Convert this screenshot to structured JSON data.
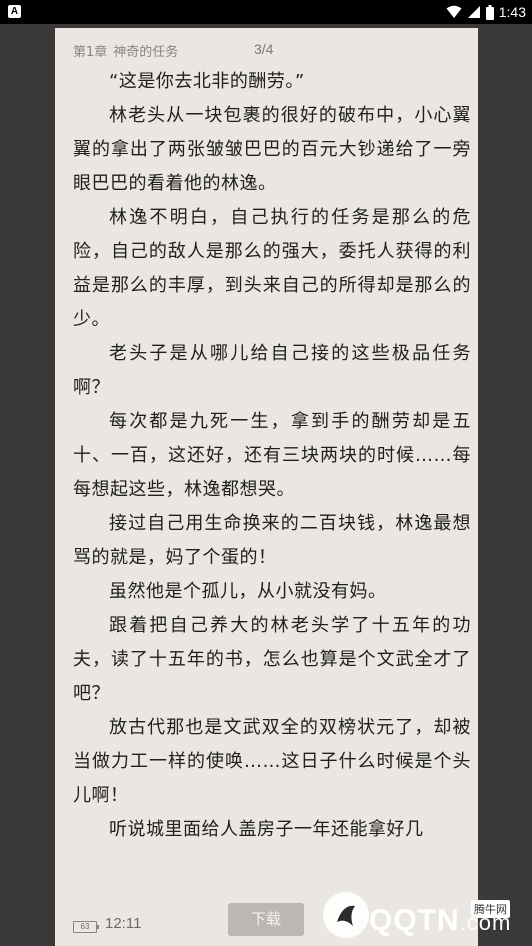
{
  "status_bar": {
    "app_icon_letter": "A",
    "time": "1:43",
    "icons": [
      "wifi-icon",
      "signal-icon",
      "battery-icon"
    ]
  },
  "reader": {
    "chapter_number": "第1章",
    "chapter_title": "神奇的任务",
    "page_indicator": "3/4",
    "paragraphs": [
      "“这是你去北非的酬劳。”",
      "林老头从一块包裹的很好的破布中，小心翼翼的拿出了两张皱皱巴巴的百元大钞递给了一旁眼巴巴的看着他的林逸。",
      "林逸不明白，自己执行的任务是那么的危险，自己的敌人是那么的强大，委托人获得的利益是那么的丰厚，到头来自己的所得却是那么的少。",
      "老头子是从哪儿给自己接的这些极品任务啊？",
      "每次都是九死一生，拿到手的酬劳却是五十、一百，这还好，还有三块两块的时候……每每想起这些，林逸都想哭。",
      "接过自己用生命换来的二百块钱，林逸最想骂的就是，妈了个蛋的！",
      "虽然他是个孤儿，从小就没有妈。",
      "跟着把自己养大的林老头学了十五年的功夫，读了十五年的书，怎么也算是个文武全才了吧？",
      "放古代那也是文武双全的双榜状元了，却被当做力工一样的使唤……这日子什么时候是个头儿啊！",
      "听说城里面给人盖房子一年还能拿好几"
    ],
    "footer": {
      "battery_level": "63",
      "time": "12:11",
      "download_label": "下载"
    }
  },
  "watermark": {
    "brand": "QQTN",
    "suffix": ".com",
    "tag": "腾牛网"
  },
  "colors": {
    "page_background": "#eae6e1",
    "text": "#1f1f1f",
    "header_text": "#8a8580",
    "download_button": "#bcb7b2",
    "outer_background": "#3a3838"
  }
}
